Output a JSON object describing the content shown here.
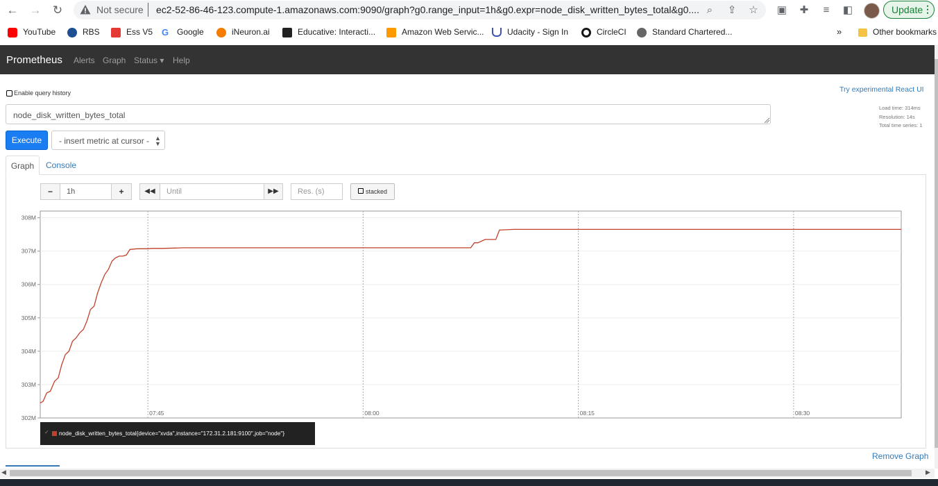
{
  "browser": {
    "not_secure": "Not secure",
    "url": "ec2-52-86-46-123.compute-1.amazonaws.com:9090/graph?g0.range_input=1h&g0.expr=node_disk_written_bytes_total&g0....",
    "update_label": "Update",
    "bookmarks": [
      {
        "label": "YouTube",
        "color": "#ff0000"
      },
      {
        "label": "RBS",
        "color": "#1d4f91"
      },
      {
        "label": "Ess V5",
        "color": "#e53935"
      },
      {
        "label": "Google",
        "color": "#4285f4"
      },
      {
        "label": "iNeuron.ai",
        "color": "#f57c00"
      },
      {
        "label": "Educative: Interacti...",
        "color": "#222222"
      },
      {
        "label": "Amazon Web Servic...",
        "color": "#ff9900"
      },
      {
        "label": "Udacity - Sign In",
        "color": "#3f51b5"
      },
      {
        "label": "CircleCI",
        "color": "#161616"
      },
      {
        "label": "Standard Chartered...",
        "color": "#555555"
      }
    ],
    "other_bookmarks": "Other bookmarks",
    "overflow": "»"
  },
  "nav": {
    "brand": "Prometheus",
    "links": [
      "Alerts",
      "Graph",
      "Status ▾",
      "Help"
    ]
  },
  "page": {
    "query_history_label": "Enable query history",
    "react_link": "Try experimental React UI",
    "stats": {
      "load_time": "Load time: 314ms",
      "resolution": "Resolution: 14s",
      "total_series": "Total time series: 1"
    },
    "expression": "node_disk_written_bytes_total",
    "execute_label": "Execute",
    "metric_select": "- insert metric at cursor -",
    "tabs": {
      "graph": "Graph",
      "console": "Console"
    },
    "controls": {
      "range": "1h",
      "until_placeholder": "Until",
      "res_placeholder": "Res. (s)",
      "stacked_label": "stacked"
    },
    "remove_graph": "Remove Graph"
  },
  "chart_data": {
    "type": "line",
    "color": "#c0412b",
    "y_tick_labels": [
      "302M",
      "303M",
      "304M",
      "305M",
      "306M",
      "307M",
      "308M"
    ],
    "x_tick_labels": [
      "07:45",
      "08:00",
      "08:15",
      "08:30"
    ],
    "ylim": [
      302,
      308.2
    ],
    "series": [
      {
        "name": "node_disk_written_bytes_total{device=\"xvda\",instance=\"172.31.2.181:9100\",job=\"node\"}",
        "x_minutes": [
          0,
          0.4,
          0.9,
          1.4,
          2.0,
          2.5,
          3.0,
          3.5,
          4.0,
          4.5,
          5.0,
          5.5,
          6.0,
          6.5,
          7.0,
          7.5,
          8.0,
          8.5,
          9.0,
          9.5,
          10.0,
          10.5,
          11.0,
          11.5,
          12.0,
          12.5,
          13.5,
          14.5,
          15.0,
          15.5,
          17.0,
          20.0,
          25.0,
          60.0,
          60.5,
          61.0,
          62.0,
          63.0,
          63.5,
          64.0,
          66.0,
          70.0,
          120.0
        ],
        "y_millions": [
          302.45,
          302.5,
          302.75,
          302.8,
          303.1,
          303.2,
          303.6,
          303.9,
          304.0,
          304.3,
          304.4,
          304.55,
          304.65,
          304.9,
          305.25,
          305.35,
          305.75,
          306.05,
          306.3,
          306.45,
          306.7,
          306.8,
          306.85,
          306.85,
          306.88,
          307.05,
          307.07,
          307.07,
          307.07,
          307.08,
          307.08,
          307.1,
          307.1,
          307.1,
          307.25,
          307.25,
          307.35,
          307.35,
          307.35,
          307.63,
          307.65,
          307.65,
          307.65
        ]
      }
    ]
  }
}
